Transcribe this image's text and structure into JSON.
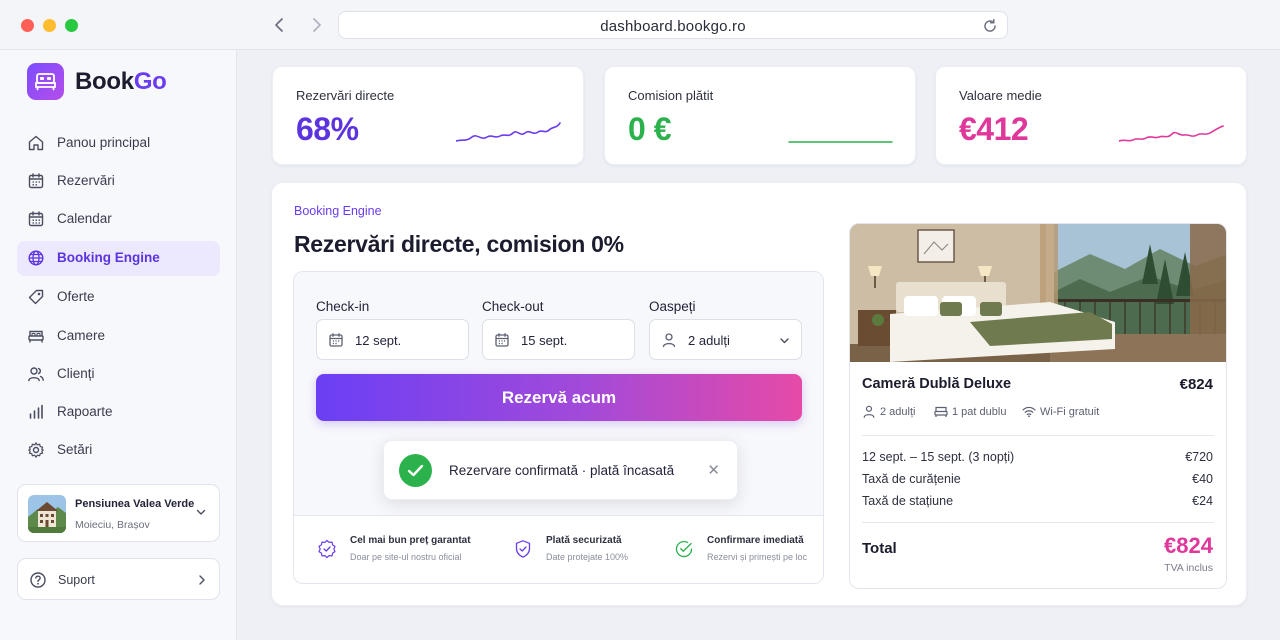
{
  "browser": {
    "url": "dashboard.bookgo.ro"
  },
  "sidebar": {
    "logo": {
      "part1": "Book",
      "part2": "Go"
    },
    "items": [
      {
        "label": "Panou principal",
        "icon": "home-icon",
        "active": false
      },
      {
        "label": "Rezervări",
        "icon": "calendar-list-icon",
        "active": false
      },
      {
        "label": "Calendar",
        "icon": "calendar-icon",
        "active": false
      },
      {
        "label": "Booking Engine",
        "icon": "globe-icon",
        "active": true
      },
      {
        "label": "Oferte",
        "icon": "tag-icon",
        "active": false
      },
      {
        "label": "Camere",
        "icon": "bed-icon",
        "active": false
      },
      {
        "label": "Clienți",
        "icon": "users-icon",
        "active": false
      },
      {
        "label": "Rapoarte",
        "icon": "bar-chart-icon",
        "active": false
      },
      {
        "label": "Setări",
        "icon": "gear-icon",
        "active": false
      }
    ],
    "property": {
      "name": "Pensiunea Valea Verde",
      "location": "Moieciu, Brașov"
    },
    "support": {
      "label": "Suport"
    }
  },
  "kpis": [
    {
      "label": "Rezervări directe",
      "value": "68%",
      "color": "#5b34e0"
    },
    {
      "label": "Comision plătit",
      "value": "0 €",
      "color": "#2bb24c"
    },
    {
      "label": "Valoare medie",
      "value": "€412",
      "color": "#e0379a"
    }
  ],
  "main": {
    "eyebrow": "Booking Engine",
    "headline": "Rezervări directe, comision 0%",
    "form": {
      "checkin_label": "Check-in",
      "checkin_value": "12 sept.",
      "checkout_label": "Check-out",
      "checkout_value": "15 sept.",
      "guests_label": "Oaspeți",
      "guests_value": "2 adulți",
      "cta": "Rezervă acum"
    },
    "toast": {
      "text": "Rezervare confirmată · plată încasată"
    },
    "features": [
      {
        "title": "Cel mai bun preț garantat",
        "subtitle": "Doar pe site-ul nostru oficial",
        "icon": "badge-icon"
      },
      {
        "title": "Plată securizată",
        "subtitle": "Date protejate 100%",
        "icon": "shield-icon"
      },
      {
        "title": "Confirmare imediată",
        "subtitle": "Rezervi și primești pe loc",
        "icon": "check-circle-icon"
      }
    ]
  },
  "room": {
    "name": "Cameră Dublă Deluxe",
    "price": "€824",
    "amenities": [
      {
        "label": "2 adulți",
        "icon": "user-icon"
      },
      {
        "label": "1 pat dublu",
        "icon": "bed-icon"
      },
      {
        "label": "Wi-Fi gratuit",
        "icon": "wifi-icon"
      }
    ],
    "lines": [
      {
        "label": "12 sept. – 15 sept. (3 nopți)",
        "value": "€720"
      },
      {
        "label": "Taxă de curățenie",
        "value": "€40"
      },
      {
        "label": "Taxă de stațiune",
        "value": "€24"
      }
    ],
    "total_label": "Total",
    "total_value": "€824",
    "total_note": "TVA inclus"
  }
}
